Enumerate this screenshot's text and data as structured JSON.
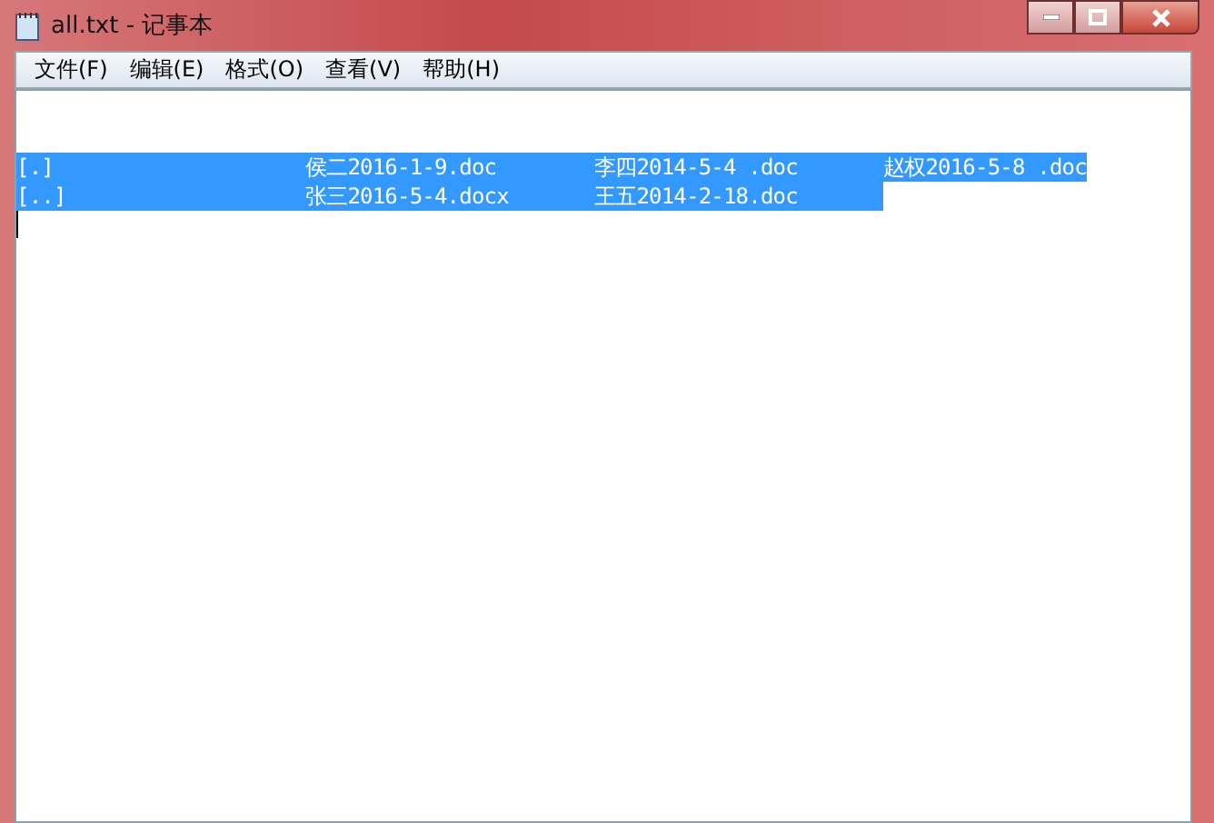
{
  "window": {
    "title": "all.txt - 记事本"
  },
  "menu": [
    "文件(F)",
    "编辑(E)",
    "格式(O)",
    "查看(V)",
    "帮助(H)"
  ],
  "editor": {
    "lines": [
      {
        "selected": true,
        "cells": [
          "[.]",
          "侯二2016-1-9.doc",
          "李四2014-5-4 .doc",
          "赵权2016-5-8 .doc"
        ]
      },
      {
        "selected": true,
        "cells": [
          "[..]",
          "张三2016-5-4.docx",
          "王五2014-2-18.doc"
        ]
      }
    ]
  }
}
